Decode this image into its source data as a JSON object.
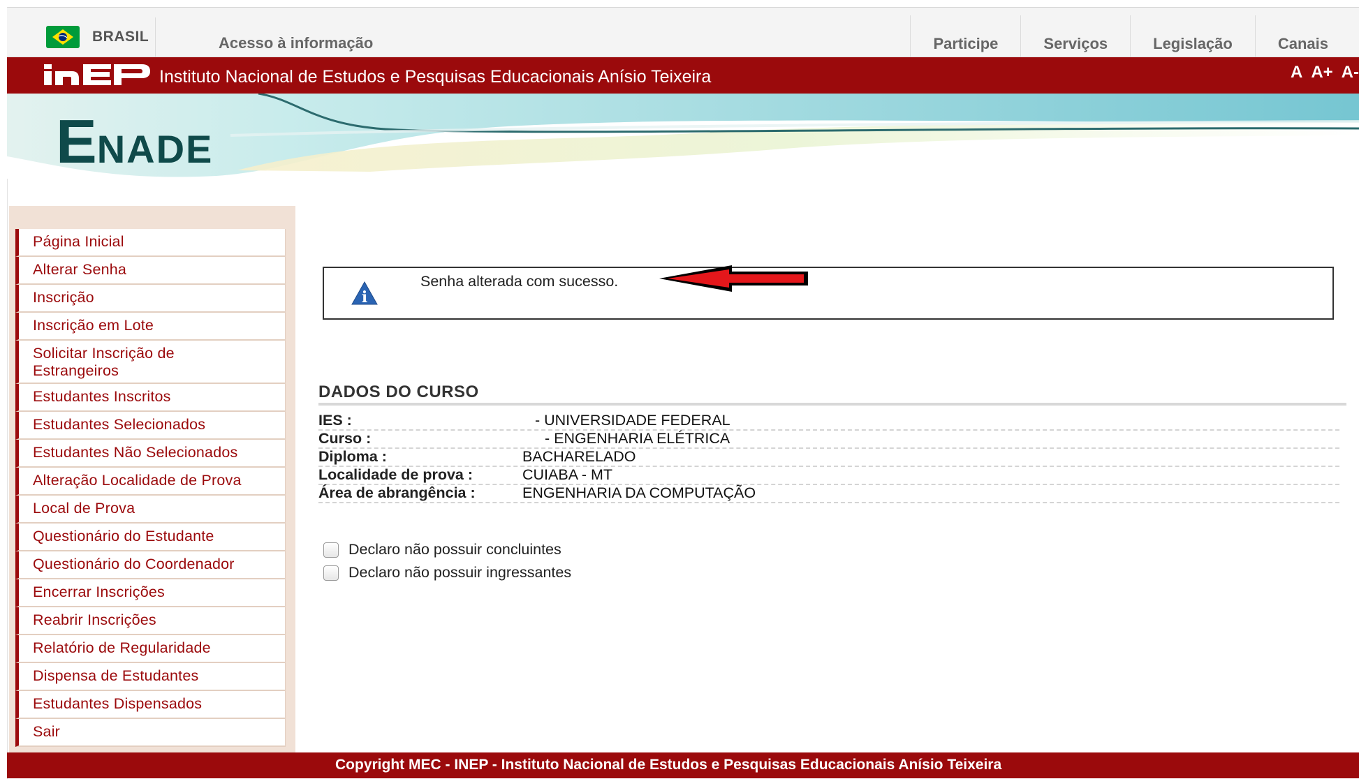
{
  "gov_bar": {
    "country": "BRASIL",
    "access_link": "Acesso à informação",
    "nav": [
      "Participe",
      "Serviços",
      "Legislação",
      "Canais"
    ]
  },
  "inep_bar": {
    "org_name": "Instituto Nacional de Estudos e Pesquisas Educacionais Anísio Teixeira",
    "font_controls": [
      "A",
      "A+",
      "A-"
    ]
  },
  "banner": {
    "title_initial": "E",
    "title_rest": "NADE"
  },
  "sidebar": {
    "items": [
      "Página Inicial",
      "Alterar Senha",
      "Inscrição",
      "Inscrição em Lote",
      "Solicitar Inscrição de Estrangeiros",
      "Estudantes Inscritos",
      "Estudantes Selecionados",
      "Estudantes Não Selecionados",
      "Alteração Localidade de Prova",
      "Local de Prova",
      "Questionário do Estudante",
      "Questionário do Coordenador",
      "Encerrar Inscrições",
      "Reabrir Inscrições",
      "Relatório de Regularidade",
      "Dispensa de Estudantes",
      "Estudantes Dispensados",
      "Sair"
    ]
  },
  "message": {
    "text": "Senha alterada com sucesso."
  },
  "course": {
    "title": "DADOS DO CURSO",
    "fields": [
      {
        "label": "IES :",
        "value": "- UNIVERSIDADE FEDERAL"
      },
      {
        "label": "Curso :",
        "value": "- ENGENHARIA ELÉTRICA"
      },
      {
        "label": "Diploma :",
        "value": "BACHARELADO"
      },
      {
        "label": "Localidade de prova :",
        "value": "CUIABA - MT"
      },
      {
        "label": "Área de abrangência :",
        "value": "ENGENHARIA DA COMPUTAÇÃO"
      }
    ]
  },
  "declarations": [
    "Declaro não possuir concluintes",
    "Declaro não possuir ingressantes"
  ],
  "footer": {
    "text": "Copyright MEC - INEP - Instituto Nacional de Estudos e Pesquisas Educacionais Anísio Teixeira"
  },
  "colors": {
    "brand_red": "#9b0a0c",
    "enade_teal": "#0f4a4a",
    "sidebar_bg": "#f1e1d6"
  }
}
